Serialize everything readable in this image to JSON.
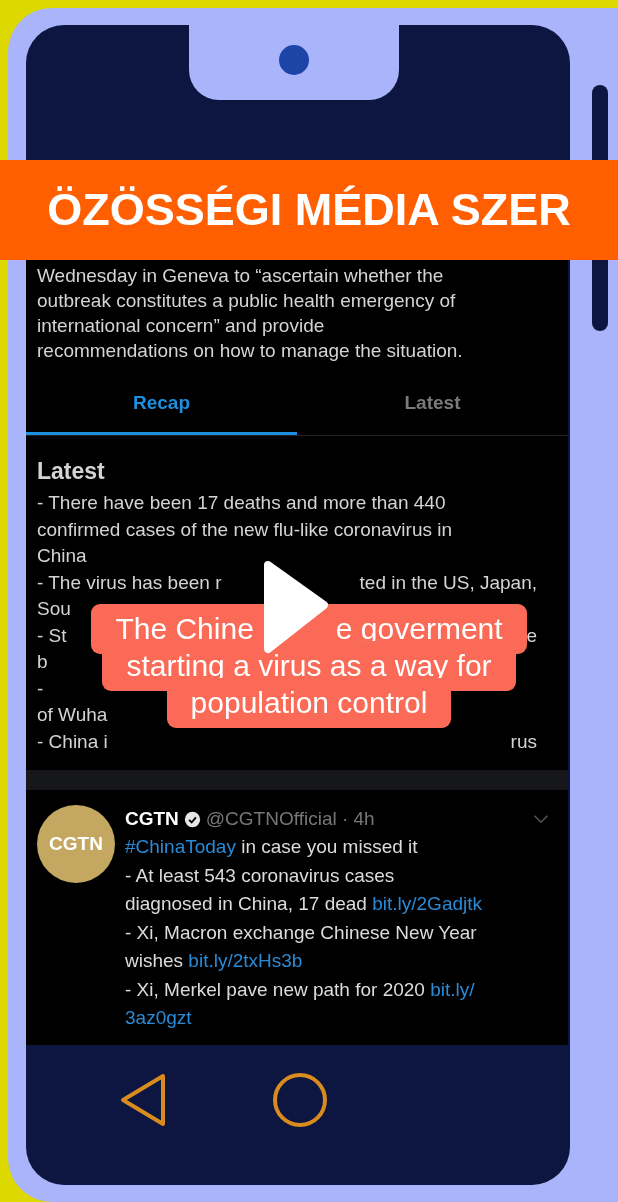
{
  "banner": {
    "text": "ÖZÖSSÉGI MÉDIA SZER"
  },
  "article": {
    "intro_lines": [
      "Wednesday in Geneva to “ascertain whether the",
      "outbreak constitutes a public health emergency of",
      "international concern” and provide",
      "recommendations on how to manage the situation."
    ]
  },
  "tabs": [
    {
      "label": "Recap",
      "selected": true
    },
    {
      "label": "Latest",
      "selected": false
    }
  ],
  "latest": {
    "heading": "Latest",
    "lines": [
      {
        "left": "- There have been 17 deaths and more than 440"
      },
      {
        "left": "confirmed cases of the new flu-like coronavirus in"
      },
      {
        "left": "China"
      },
      {
        "left": "- The virus has been r",
        "right": "ted in the US, Japan,"
      },
      {
        "left": "Sou"
      },
      {
        "left": "- St",
        "right": "e"
      },
      {
        "left": "b"
      },
      {
        "left": "-"
      },
      {
        "left": "of Wuha"
      },
      {
        "left": "- China i",
        "right": "rus"
      }
    ]
  },
  "tweet": {
    "avatar_text": "CGTN",
    "name": "CGTN",
    "verified": true,
    "handle": "@CGTNOfficial · 4h",
    "body_lines": [
      [
        {
          "kind": "hashtag",
          "text": "#ChinaToday"
        },
        {
          "kind": "text",
          "text": " in case you missed it"
        }
      ],
      [
        {
          "kind": "text",
          "text": "- At least 543 coronavirus cases"
        }
      ],
      [
        {
          "kind": "text",
          "text": "diagnosed in China, 17 dead "
        },
        {
          "kind": "link",
          "text": "bit.ly/2Gadjtk"
        }
      ],
      [
        {
          "kind": "text",
          "text": "- Xi, Macron exchange Chinese New Year"
        }
      ],
      [
        {
          "kind": "text",
          "text": "wishes "
        },
        {
          "kind": "link",
          "text": "bit.ly/2txHs3b"
        }
      ],
      [
        {
          "kind": "text",
          "text": "- Xi, Merkel pave new path for 2020 "
        },
        {
          "kind": "link",
          "text": "bit.ly/"
        }
      ],
      [
        {
          "kind": "link",
          "text": "3az0gzt"
        }
      ]
    ]
  },
  "caption": {
    "lines": [
      [
        "The Chine",
        "e goverment"
      ],
      [
        "starting a virus as a way for"
      ],
      [
        "population control"
      ]
    ]
  }
}
